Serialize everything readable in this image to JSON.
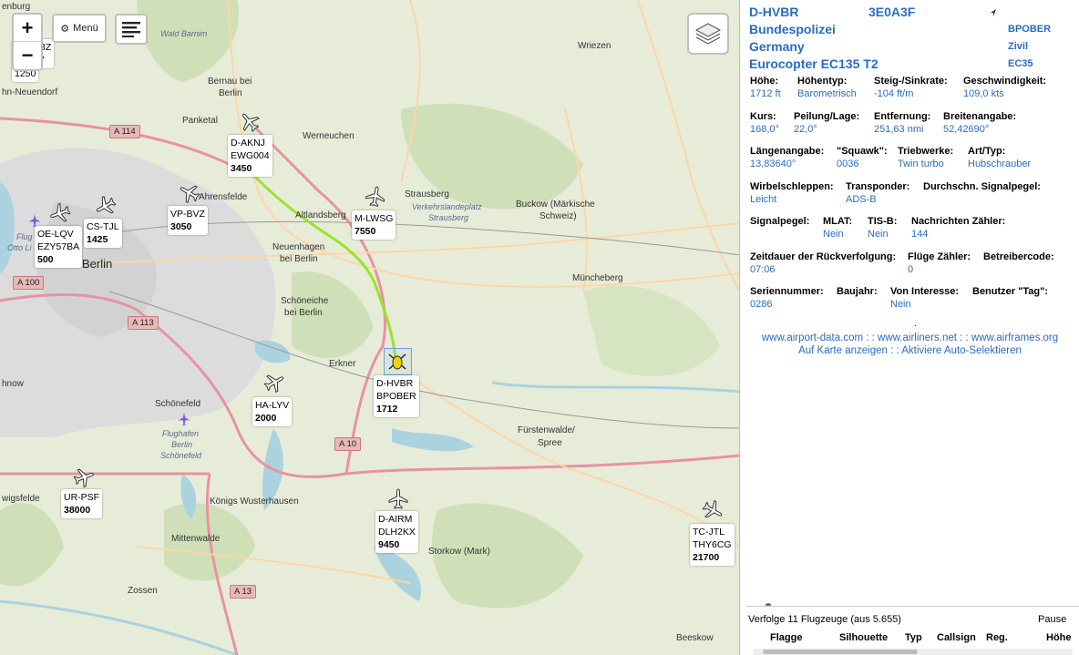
{
  "map": {
    "zoom_in": "+",
    "zoom_out": "−",
    "menu_label": "Menü",
    "cities": [
      {
        "name": "Berlin",
        "big": true
      },
      {
        "name": "Bernau bei"
      },
      {
        "name": "Berlin"
      },
      {
        "name": "Panketal"
      },
      {
        "name": "Werneuchen"
      },
      {
        "name": "Ahrensfelde"
      },
      {
        "name": "Altlandsberg"
      },
      {
        "name": "Strausberg"
      },
      {
        "name": "Neuenhagen"
      },
      {
        "name": "bei Berlin"
      },
      {
        "name": "Schöneiche"
      },
      {
        "name": "bei Berlin"
      },
      {
        "name": "Erkner"
      },
      {
        "name": "Schönefeld"
      },
      {
        "name": "Königs Wusterhausen"
      },
      {
        "name": "Mittenwalde"
      },
      {
        "name": "Zossen"
      },
      {
        "name": "Storkow (Mark)"
      },
      {
        "name": "Fürstenwalde/"
      },
      {
        "name": "Spree"
      },
      {
        "name": "Müncheberg"
      },
      {
        "name": "Buckow (Märkische"
      },
      {
        "name": "Schweiz)"
      },
      {
        "name": "Wriezen"
      },
      {
        "name": "Beeskow"
      },
      {
        "name": "wigsfelde"
      },
      {
        "name": "hn-Neuendorf"
      },
      {
        "name": "enburg"
      },
      {
        "name": "hnow"
      },
      {
        "name": "Wald Barnim",
        "ital": true
      },
      {
        "name": "Verkehrslandeplatz",
        "ital": true
      },
      {
        "name": "Strausberg",
        "ital": true
      },
      {
        "name": "Flughafen",
        "ital": true
      },
      {
        "name": "Berlin",
        "ital": true
      },
      {
        "name": "Schönefeld",
        "ital": true
      },
      {
        "name": "Flug",
        "ital": true
      },
      {
        "name": "Otto Li",
        "ital": true
      }
    ],
    "roads": [
      "A 114",
      "A 100",
      "A 113",
      "A 10",
      "A 13"
    ],
    "aircraft": [
      {
        "reg": "D-AKNJ",
        "call": "EWG004",
        "alt": "3450"
      },
      {
        "reg": "VP-BVZ",
        "call": "",
        "alt": "3050"
      },
      {
        "reg": "CS-TJL",
        "call": "",
        "alt": "1425"
      },
      {
        "reg": "OE-LQV",
        "call": "EZY57BA",
        "alt": "500"
      },
      {
        "reg": "M-LWSG",
        "call": "",
        "alt": "7550"
      },
      {
        "reg": "D-HVBR",
        "call": "BPOBER",
        "alt": "1712"
      },
      {
        "reg": "HA-LYV",
        "call": "",
        "alt": "2000"
      },
      {
        "reg": "UR-PSF",
        "call": "",
        "alt": "38000"
      },
      {
        "reg": "D-AIRM",
        "call": "DLH2KX",
        "alt": "9450"
      },
      {
        "reg": "TC-JTL",
        "call": "THY6CG",
        "alt": "21700"
      },
      {
        "reg": "BZ",
        "call": "7",
        "alt": "1250"
      }
    ]
  },
  "side": {
    "reg": "D-HVBR",
    "hex": "3E0A3F",
    "callsign": "BPOBER",
    "operator": "Bundespolizei",
    "country": "Germany",
    "category": "Zivil",
    "type": "Eurocopter EC135 T2",
    "icao_type": "EC35",
    "fields": [
      {
        "label": "Höhe:",
        "value": "1712 ft"
      },
      {
        "label": "Höhentyp:",
        "value": "Barometrisch"
      },
      {
        "label": "Steig-/Sinkrate:",
        "value": "-104 ft/m"
      },
      {
        "label": "Geschwindigkeit:",
        "value": "109,0 kts"
      },
      {
        "label": "Kurs:",
        "value": "168,0°"
      },
      {
        "label": "Peilung/Lage:",
        "value": "22,0°"
      },
      {
        "label": "Entfernung:",
        "value": "251,63 nmi"
      },
      {
        "label": "Breitenangabe:",
        "value": "52,42690°"
      },
      {
        "label": "Längenangabe:",
        "value": "13,83640°"
      },
      {
        "label": "\"Squawk\":",
        "value": "0036"
      },
      {
        "label": "Triebwerke:",
        "value": "Twin turbo"
      },
      {
        "label": "Art/Typ:",
        "value": "Hubschrauber"
      },
      {
        "label": "Wirbelschleppen:",
        "value": "Leicht"
      },
      {
        "label": "Transponder:",
        "value": "ADS-B"
      },
      {
        "label": "Durchschn. Signalpegel:",
        "value": ""
      },
      {
        "label": "Signalpegel:",
        "value": ""
      },
      {
        "label": "MLAT:",
        "value": "Nein"
      },
      {
        "label": "TIS-B:",
        "value": "Nein"
      },
      {
        "label": "Nachrichten Zähler:",
        "value": "144"
      },
      {
        "label": "Zeitdauer der Rückverfolgung:",
        "value": "07:06"
      },
      {
        "label": "Flüge Zähler:",
        "value": "0"
      },
      {
        "label": "Betreibercode:",
        "value": ""
      },
      {
        "label": "Seriennummer:",
        "value": "0286"
      },
      {
        "label": "Baujahr:",
        "value": ""
      },
      {
        "label": "Von Interesse:",
        "value": "Nein"
      },
      {
        "label": "Benutzer \"Tag\":",
        "value": ""
      }
    ],
    "dot": ".",
    "links1": "www.airport-data.com : : www.airliners.net : : www.airframes.org",
    "links2": "Auf Karte anzeigen : : Aktiviere Auto-Selektieren",
    "tracking": "Verfolge 11 Flugzeuge (aus 5.655)",
    "pause": "Pause",
    "columns": [
      "Flagge",
      "Silhouette",
      "Typ",
      "Callsign",
      "Reg.",
      "Höhe"
    ]
  }
}
